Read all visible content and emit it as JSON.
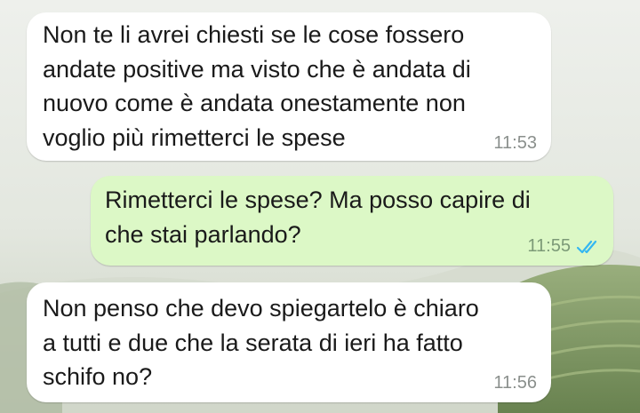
{
  "messages": [
    {
      "direction": "incoming",
      "text": "Non te li avrei chiesti se le cose fossero\nandate positive ma visto che è andata di\nnuovo come è andata onestamente non\nvoglio più rimetterci le spese",
      "time": "11:53"
    },
    {
      "direction": "outgoing",
      "text": "Rimetterci le spese? Ma posso capire di\nche stai parlando?",
      "time": "11:55",
      "status_icon": "double-check-read-icon"
    },
    {
      "direction": "incoming",
      "text": "Non penso che devo spiegartelo è chiaro\na tutti e due che la serata di ieri ha fatto\nschifo no?",
      "time": "11:56"
    }
  ],
  "colors": {
    "incoming_bubble": "#ffffff",
    "outgoing_bubble": "#dcf8c6",
    "read_ticks": "#34b7f1"
  }
}
